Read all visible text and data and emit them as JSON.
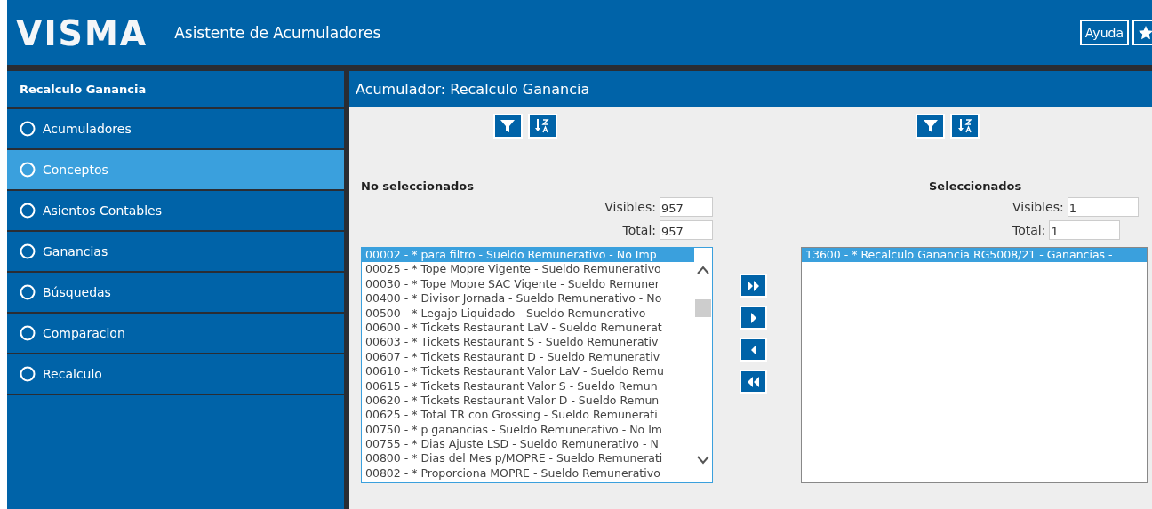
{
  "header": {
    "logo": "VISMA",
    "title": "Asistente de Acumuladores",
    "help_button": "Ayuda"
  },
  "sidebar": {
    "title": "Recalculo Ganancia",
    "items": [
      {
        "label": "Acumuladores",
        "selected": false
      },
      {
        "label": "Conceptos",
        "selected": true
      },
      {
        "label": "Asientos Contables",
        "selected": false
      },
      {
        "label": "Ganancias",
        "selected": false
      },
      {
        "label": "Búsquedas",
        "selected": false
      },
      {
        "label": "Comparacion",
        "selected": false
      },
      {
        "label": "Recalculo",
        "selected": false
      }
    ]
  },
  "main": {
    "title": "Acumulador: Recalculo Ganancia",
    "panels": [
      {
        "heading": "No seleccionados",
        "visibles_label": "Visibles:",
        "visibles": "957",
        "total_label": "Total:",
        "total": "957",
        "scrollbar": true,
        "items": [
          {
            "text": "00002 - * para filtro - Sueldo Remunerativo - No Imp",
            "selected": true
          },
          {
            "text": "00025 - * Tope Mopre Vigente - Sueldo Remunerativo",
            "selected": false
          },
          {
            "text": "00030 - * Tope Mopre SAC Vigente - Sueldo Remuner",
            "selected": false
          },
          {
            "text": "00400 - * Divisor Jornada - Sueldo Remunerativo - No",
            "selected": false
          },
          {
            "text": "00500 - * Legajo Liquidado - Sueldo Remunerativo -",
            "selected": false
          },
          {
            "text": "00600 - * Tickets Restaurant LaV - Sueldo Remunerat",
            "selected": false
          },
          {
            "text": "00603 - * Tickets Restaurant S - Sueldo Remunerativ",
            "selected": false
          },
          {
            "text": "00607 - * Tickets Restaurant D - Sueldo Remunerativ",
            "selected": false
          },
          {
            "text": "00610 - * Tickets Restaurant Valor LaV - Sueldo Remu",
            "selected": false
          },
          {
            "text": "00615 - * Tickets Restaurant Valor S - Sueldo Remun",
            "selected": false
          },
          {
            "text": "00620 - * Tickets Restaurant Valor D - Sueldo Remun",
            "selected": false
          },
          {
            "text": "00625 - * Total TR con Grossing - Sueldo Remunerati",
            "selected": false
          },
          {
            "text": "00750 - * p ganancias - Sueldo Remunerativo - No Im",
            "selected": false
          },
          {
            "text": "00755 - * Dias Ajuste LSD - Sueldo Remunerativo - N",
            "selected": false
          },
          {
            "text": "00800 - * Dias del Mes p/MOPRE - Sueldo Remunerati",
            "selected": false
          },
          {
            "text": "00802 - * Proporciona MOPRE - Sueldo Remunerativo",
            "selected": false
          }
        ]
      },
      {
        "heading": "Seleccionados",
        "visibles_label": "Visibles:",
        "visibles": "1",
        "total_label": "Total:",
        "total": "1",
        "scrollbar": false,
        "items": [
          {
            "text": "13600 - * Recalculo Ganancia RG5008/21 - Ganancias -",
            "selected": true
          }
        ]
      }
    ]
  }
}
